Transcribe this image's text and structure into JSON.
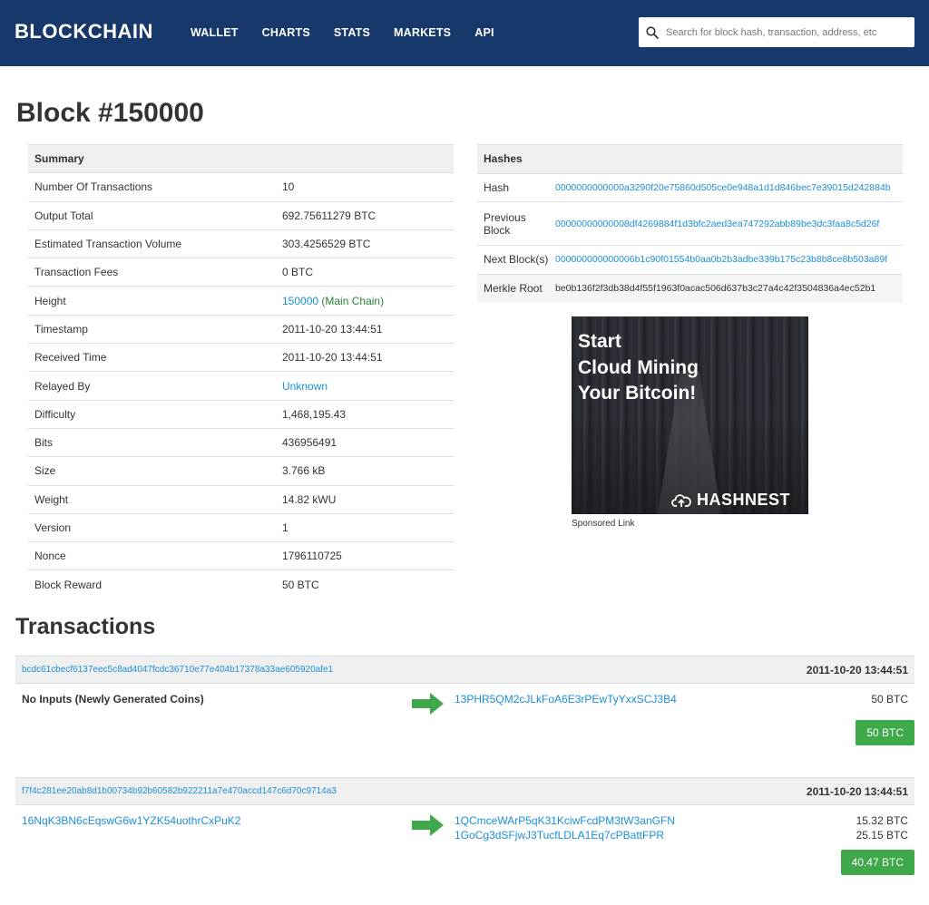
{
  "header": {
    "logo": "BLOCKCHAIN",
    "nav": [
      "WALLET",
      "CHARTS",
      "STATS",
      "MARKETS",
      "API"
    ],
    "search_placeholder": "Search for block hash, transaction, address, etc",
    "bg_color": "#17386a"
  },
  "page_title": "Block #150000",
  "summary": {
    "heading": "Summary",
    "rows": [
      {
        "label": "Number Of Transactions",
        "value": "10"
      },
      {
        "label": "Output Total",
        "value": "692.75611279 BTC"
      },
      {
        "label": "Estimated Transaction Volume",
        "value": "303.4256529 BTC"
      },
      {
        "label": "Transaction Fees",
        "value": "0 BTC"
      },
      {
        "label": "Height",
        "value": "150000",
        "extra": "(Main Chain)"
      },
      {
        "label": "Timestamp",
        "value": "2011-10-20 13:44:51"
      },
      {
        "label": "Received Time",
        "value": "2011-10-20 13:44:51"
      },
      {
        "label": "Relayed By",
        "value": "Unknown"
      },
      {
        "label": "Difficulty",
        "value": "1,468,195.43"
      },
      {
        "label": "Bits",
        "value": "436956491"
      },
      {
        "label": "Size",
        "value": "3.766 kB"
      },
      {
        "label": "Weight",
        "value": "14.82 kWU"
      },
      {
        "label": "Version",
        "value": "1"
      },
      {
        "label": "Nonce",
        "value": "1796110725"
      },
      {
        "label": "Block Reward",
        "value": "50 BTC"
      }
    ]
  },
  "hashes": {
    "heading": "Hashes",
    "rows": [
      {
        "label": "Hash",
        "value": "0000000000000a3290f20e75860d505ce0e948a1d1d846bec7e39015d242884b"
      },
      {
        "label": "Previous Block",
        "value": "00000000000008df4269884f1d3bfc2aed3ea747292abb89be3dc3faa8c5d26f"
      },
      {
        "label": "Next Block(s)",
        "value": "000000000000006b1c90f01554b0aa0b2b3adbe339b175c23b8b8ce8b503a89f"
      },
      {
        "label": "Merkle Root",
        "value": "be0b136f2f3db38d4f55f1963f0acac506d637b3c27a4c42f3504836a4ec52b1"
      }
    ]
  },
  "ad": {
    "headline": [
      "Start",
      "Cloud Mining",
      "Your Bitcoin!"
    ],
    "brand": "HASHNEST",
    "sponsored": "Sponsored Link"
  },
  "transactions_title": "Transactions",
  "transactions": [
    {
      "hash": "bcdc61cbecf6137eec5c8ad4047fcdc36710e77e404b17378a33ae605920afe1",
      "time": "2011-10-20 13:44:51",
      "from": "No Inputs (Newly Generated Coins)",
      "outputs": [
        "13PHR5QM2cJLkFoA6E3rPEwTyYxxSCJ3B4"
      ],
      "amounts": [
        "50 BTC"
      ],
      "total": "50 BTC"
    },
    {
      "hash": "f7f4c281ee20ab8d1b00734b92b60582b922211a7e470accd147c6d70c9714a3",
      "time": "2011-10-20 13:44:51",
      "from": "16NqK3BN6cEqswG6w1YZK54uothrCxPuK2",
      "outputs": [
        "1QCmceWArP5qK31KciwFcdPM3tW3anGFN",
        "1GoCg3dSFjwJ3TucfLDLA1Eq7cPBattFPR"
      ],
      "amounts": [
        "15.32 BTC",
        "25.15 BTC"
      ],
      "total": "40.47 BTC"
    }
  ]
}
